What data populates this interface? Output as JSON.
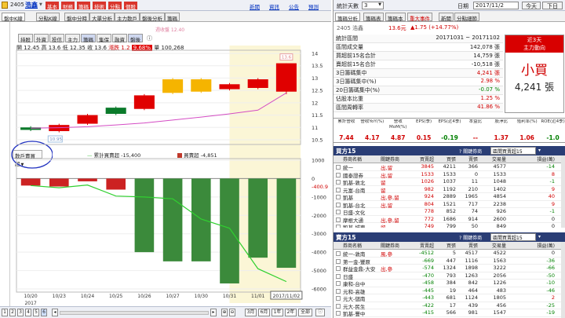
{
  "topbar": {
    "code": "2405",
    "name": "浩鑫",
    "buttons": [
      "基本",
      "財務",
      "籌碼",
      "技術",
      "分點",
      "個股"
    ],
    "links": [
      "新聞",
      "資訊",
      "公告",
      "預測"
    ]
  },
  "tabs": [
    "盤中K線",
    "分點K線",
    "盤中分時",
    "大單分析",
    "主力散戶",
    "盤後分析",
    "籌碼"
  ],
  "chart": {
    "toolbar": [
      "持股",
      "外資",
      "投信",
      "主力",
      "籌碼",
      "集保",
      "融資",
      "盤後"
    ],
    "toolbar_note": "ⓘ",
    "ohlc": {
      "open_label": "開",
      "open": "12.45",
      "high_label": "高",
      "high": "13.6",
      "close_label": "收",
      "close": "13.6",
      "low_label": "低",
      "low": "12.35",
      "chg_label": "漲跌",
      "chg": "1.2",
      "pct": "9.68%",
      "vol_label": "量",
      "vol": "100,268"
    },
    "ma_label": "週收盤 12.40",
    "price_axis": [
      "14",
      "13.5",
      "13",
      "12.5",
      "12",
      "11.5",
      "11",
      "10.5"
    ],
    "pmax_tag": "13.6",
    "pmin_tag": "10.95",
    "panel2_label": "散戶賣買超",
    "legend1": "累計買賣超 -15,400",
    "legend2": "買賣超 -4,851",
    "lower_axis": [
      "1000",
      "0",
      "-1000",
      "-2000",
      "-3000",
      "-4000",
      "-5000",
      "-6000"
    ],
    "last_tag": "-400.9",
    "dates": [
      "10/20",
      "10/23",
      "10/24",
      "10/25",
      "10/26",
      "10/27",
      "10/30",
      "10/31",
      "11/01",
      "2017/11/02"
    ],
    "year": "2017",
    "candles": [
      {
        "d": "10/20",
        "o": 11.0,
        "c": 10.9,
        "h": 11.05,
        "l": 10.85
      },
      {
        "d": "10/23",
        "o": 10.85,
        "c": 11.1,
        "h": 11.15,
        "l": 10.8
      },
      {
        "d": "10/24",
        "o": 11.15,
        "c": 11.5,
        "h": 11.55,
        "l": 11.1
      },
      {
        "d": "10/25",
        "o": 11.8,
        "c": 11.55,
        "h": 11.85,
        "l": 11.5
      },
      {
        "d": "10/26",
        "o": 11.75,
        "c": 12.3,
        "h": 12.35,
        "l": 11.7
      },
      {
        "d": "10/27",
        "o": 12.4,
        "c": 12.95,
        "h": 13.0,
        "l": 12.35
      },
      {
        "d": "10/30",
        "o": 12.45,
        "c": 12.95,
        "h": 13.0,
        "l": 12.4
      },
      {
        "d": "10/31",
        "o": 12.55,
        "c": 12.75,
        "h": 12.8,
        "l": 12.5
      },
      {
        "d": "11/01",
        "o": 12.6,
        "c": 12.95,
        "h": 13.0,
        "l": 12.55
      },
      {
        "d": "11/02",
        "o": 12.45,
        "c": 13.6,
        "h": 13.6,
        "l": 12.35
      }
    ],
    "ma": [
      10.97,
      10.99,
      11.03,
      11.1,
      11.18,
      11.3,
      11.42,
      11.55,
      11.7,
      12.4
    ],
    "bars": [
      {
        "d": "10/20",
        "v": -380
      },
      {
        "d": "10/23",
        "v": -430
      },
      {
        "d": "10/24",
        "v": -150
      },
      {
        "d": "10/25",
        "v": -600
      },
      {
        "d": "10/26",
        "v": -4000
      },
      {
        "d": "10/27",
        "v": -4500
      },
      {
        "d": "10/30",
        "v": -4500
      },
      {
        "d": "10/31",
        "v": -5700
      },
      {
        "d": "11/01",
        "v": -4300
      },
      {
        "d": "11/02",
        "v": -4850
      }
    ],
    "cum": [
      -380,
      -500,
      -350,
      -950,
      -1000,
      -1100,
      -2200,
      -2700,
      -4900,
      -5600
    ]
  },
  "bottom": {
    "pages": [
      "1",
      "2",
      "3",
      "4",
      "5",
      "6"
    ],
    "ranges": [
      "3月",
      "6月",
      "1年",
      "2年",
      "全部"
    ],
    "tail": "ⓘ"
  },
  "right": {
    "stat_label": "統計天數",
    "stat_days": "3",
    "date": "2017/11/2",
    "btn_today": "今天",
    "btn_next": "下日",
    "tabs": [
      "籌碼分析",
      "籌碼表",
      "籌碼本",
      "重大事件",
      "新聞",
      "分點細節"
    ],
    "stock": "2405 浩鑫",
    "price": "13.6元",
    "chg": "▲1.75 (+14.77%)",
    "summary": [
      {
        "k": "統計區間",
        "v": "20171031 ~ 20171102"
      },
      {
        "k": "區間成交量",
        "v": "142,078 張"
      },
      {
        "k": "買超前15名合計",
        "v": "14,759 張"
      },
      {
        "k": "賣超前15名合計",
        "v": "-10,518 張"
      },
      {
        "k": "3日籌碼集中",
        "v": "4,241 張"
      },
      {
        "k": "3日籌碼集中(%)",
        "v": "2.98 %"
      },
      {
        "k": "20日籌碼集中(%)",
        "v": "-0.07 %"
      },
      {
        "k": "佔股本比重",
        "v": "1.25 %"
      },
      {
        "k": "區間周轉率",
        "v": "41.86 %"
      }
    ],
    "side": {
      "title": "近3天",
      "sub": "主力動向",
      "big": "小買",
      "amount": "4,241 張"
    },
    "metrics": {
      "heads": [
        "累計營收",
        "營收YoY(%)",
        "營收MoM(%)",
        "EPS(季)",
        "EPS(近4季)",
        "本益比",
        "股淨比",
        "殖利率(%)",
        "ROE(近4季)"
      ],
      "vals": [
        "7.44",
        "4.17",
        "4.87",
        "0.15",
        "-0.19",
        "--",
        "1.37",
        "1.06",
        "-1.0"
      ]
    },
    "buy": {
      "title": "買方15",
      "ctrl": "區間買賣超15",
      "heads": [
        "",
        "券商名稱",
        "關鍵券商",
        "買賣超",
        "買張",
        "賣張",
        "交易量",
        "損益(萬)"
      ],
      "rows": [
        [
          "統一",
          "出,留",
          "3845",
          "4211",
          "366",
          "4577",
          "-14"
        ],
        [
          "國泰證券",
          "出,留",
          "1533",
          "1533",
          "0",
          "1533",
          "8"
        ],
        [
          "凱基-敦北",
          "留",
          "1026",
          "1037",
          "11",
          "1048",
          "-1"
        ],
        [
          "元富-台南",
          "留",
          "982",
          "1192",
          "210",
          "1402",
          "9"
        ],
        [
          "凱基",
          "出,參,留",
          "924",
          "2889",
          "1965",
          "4854",
          "40"
        ],
        [
          "凱基-台北",
          "出,留",
          "804",
          "1521",
          "717",
          "2238",
          "9"
        ],
        [
          "日盛-文化",
          "",
          "778",
          "852",
          "74",
          "926",
          "-1"
        ],
        [
          "摩根大通",
          "出,參,留",
          "772",
          "1686",
          "914",
          "2600",
          "0"
        ],
        [
          "凱基-城東",
          "留",
          "749",
          "799",
          "50",
          "849",
          "0"
        ]
      ]
    },
    "sell": {
      "title": "賣方15",
      "ctrl": "區間買賣超15",
      "heads": [
        "",
        "券商名稱",
        "關鍵券商",
        "賣賣超",
        "買張",
        "賣張",
        "交易量",
        "損益(萬)"
      ],
      "rows": [
        [
          "統一-敦南",
          "風,參",
          "-4512",
          "5",
          "4517",
          "4522",
          "0"
        ],
        [
          "第一金-豐原",
          "",
          "-669",
          "447",
          "1116",
          "1563",
          "-36"
        ],
        [
          "群益金鼎-大安",
          "出,參",
          "-574",
          "1324",
          "1898",
          "3222",
          "-66"
        ],
        [
          "日盛",
          "",
          "-470",
          "793",
          "1263",
          "2056",
          "-50"
        ],
        [
          "康和-台中",
          "",
          "-458",
          "384",
          "842",
          "1226",
          "-10"
        ],
        [
          "元和-高雄",
          "",
          "-445",
          "19",
          "464",
          "483",
          "-46"
        ],
        [
          "元大-儲南",
          "",
          "-443",
          "681",
          "1124",
          "1805",
          "2"
        ],
        [
          "元大-民生",
          "",
          "-422",
          "17",
          "439",
          "456",
          "-25"
        ],
        [
          "凱基-豐中",
          "",
          "-415",
          "566",
          "981",
          "1547",
          "-19"
        ]
      ]
    }
  }
}
